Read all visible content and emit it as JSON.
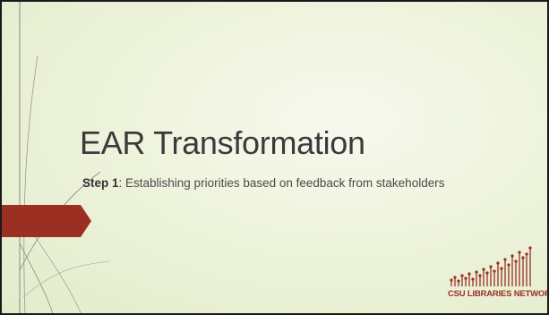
{
  "slide": {
    "title": "EAR Transformation",
    "subtitle": {
      "step_label": "Step 1",
      "text": ": Establishing priorities based on feedback from stakeholders"
    },
    "logo": {
      "text": "CSU LIBRARIES NETWORK",
      "color": "#9b2f22"
    }
  },
  "theme": {
    "background": "#eef3dc",
    "accent": "#9b2f22",
    "text": "#3b3b3b"
  }
}
